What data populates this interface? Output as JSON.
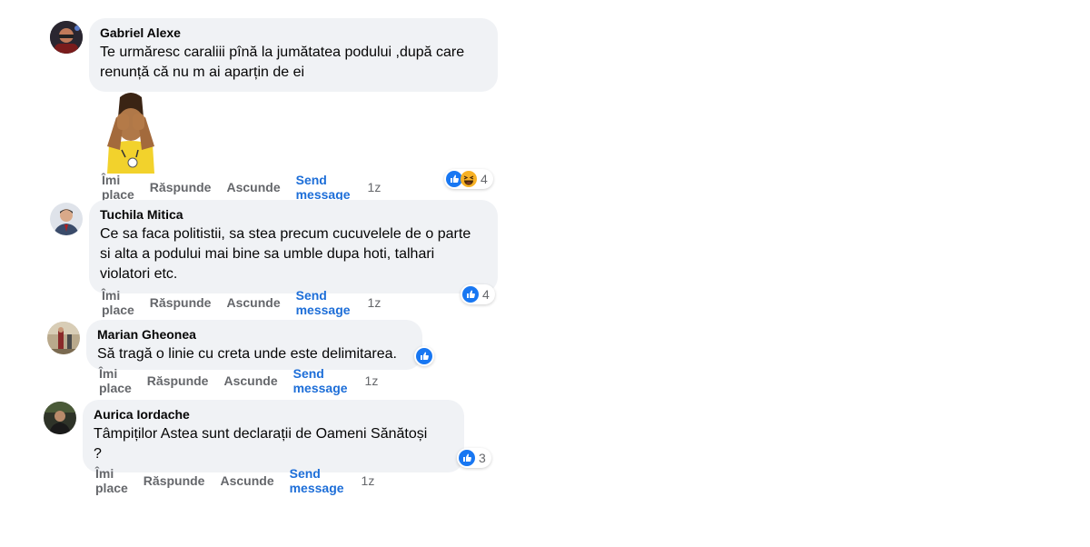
{
  "actions": {
    "like": "Îmi place",
    "reply": "Răspunde",
    "hide": "Ascunde",
    "send": "Send message"
  },
  "colors": {
    "bubble": "#f0f2f5",
    "link": "#1d6ed8",
    "meta": "#65676b",
    "like_blue": "#1877f2"
  },
  "comments": [
    {
      "author": "Gabriel Alexe",
      "text": "Te urmăresc caraliii pînă la jumătatea podului ,după care\nrenunță că nu m ai aparțin de ei",
      "time": "1z",
      "reactions": [
        "like-icon",
        "haha-icon"
      ],
      "reaction_count": "4",
      "has_sticker": true
    },
    {
      "author": "Tuchila Mitica",
      "text": "Ce sa faca politistii, sa stea precum cucuvelele de o parte\nsi alta a podului mai bine sa umble dupa hoti, talhari\nviolatori etc.",
      "time": "1z",
      "reactions": [
        "like-icon"
      ],
      "reaction_count": "4"
    },
    {
      "author": "Marian Gheonea",
      "text": "Să tragă o linie cu creta unde este delimitarea.",
      "time": "1z",
      "reactions": [
        "like-icon"
      ],
      "reaction_count": ""
    },
    {
      "author": "Aurica Iordache",
      "text": "Tâmpiților Astea sunt declarații de Oameni Sănătoși\n?",
      "time": "1z",
      "reactions": [
        "like-icon"
      ],
      "reaction_count": "3"
    }
  ]
}
